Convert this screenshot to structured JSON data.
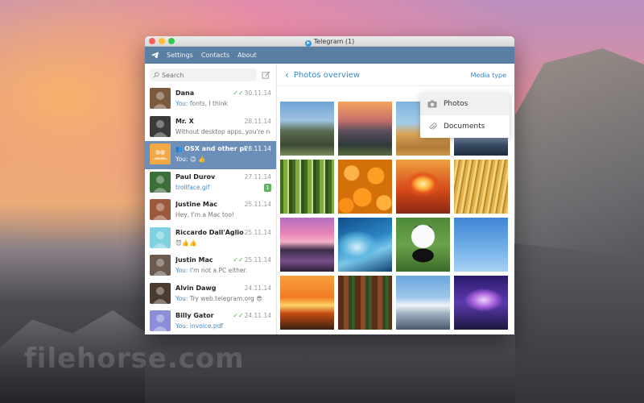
{
  "window": {
    "title": "Telegram (1)"
  },
  "menu": {
    "items": [
      "Settings",
      "Contacts",
      "About"
    ]
  },
  "search": {
    "placeholder": "Search"
  },
  "chats": [
    {
      "name": "Dana",
      "date": "30.11.14",
      "you": "You:",
      "message": "fonts, I think",
      "read": true,
      "avatar_color": "#7c5a3d"
    },
    {
      "name": "Mr. X",
      "date": "28.11.14",
      "you": "",
      "message": "Without desktop apps, you're not...",
      "avatar_color": "#3b3b3b"
    },
    {
      "name": "OSX and other platf...",
      "date": "28.11.14",
      "you": "You:",
      "message": "😊 👍",
      "active": true,
      "group": true,
      "avatar_color": "#f2a845"
    },
    {
      "name": "Paul Durov",
      "date": "27.11.14",
      "you": "",
      "message": "trollface.gif",
      "badge": "1",
      "link": true,
      "avatar_color": "#3c6e3a"
    },
    {
      "name": "Justine Mac",
      "date": "25.11.14",
      "you": "",
      "message": "Hey, I'm a Mac too!",
      "avatar_color": "#9c5a3c"
    },
    {
      "name": "Riccardo Dall'Aglio",
      "date": "25.11.14",
      "you": "",
      "message": "😈👍👍",
      "avatar_color": "#7fd1e0"
    },
    {
      "name": "Justin Mac",
      "date": "25.11.14",
      "you": "You:",
      "message": "I'm not a PC either.",
      "read": true,
      "avatar_color": "#6b5a4d"
    },
    {
      "name": "Alvin Dawg",
      "date": "24.11.14",
      "you": "You:",
      "message": "Try web.telegram.org 😎",
      "avatar_color": "#4a3b2e"
    },
    {
      "name": "Billy Gator",
      "date": "24.11.14",
      "you": "You:",
      "message": "invoice.pdf",
      "link": true,
      "read": true,
      "avatar_color": "#8c8fd8"
    }
  ],
  "header": {
    "back_label": "Photos overview",
    "media_type": "Media type"
  },
  "dropdown": {
    "items": [
      "Photos",
      "Documents"
    ]
  },
  "photos": [
    "yosemite-valley",
    "sunset-valley",
    "desert-rocks",
    "mountain-dusk",
    "bamboo",
    "oranges",
    "nuclear-explosion",
    "wheat-field",
    "surfer-sunset",
    "ocean-wave",
    "panda",
    "birds-sky",
    "sunset-birds",
    "redwood-forest",
    "snowy-mountains",
    "purple-sky"
  ],
  "background": {
    "watermark": "filehorse.com"
  }
}
